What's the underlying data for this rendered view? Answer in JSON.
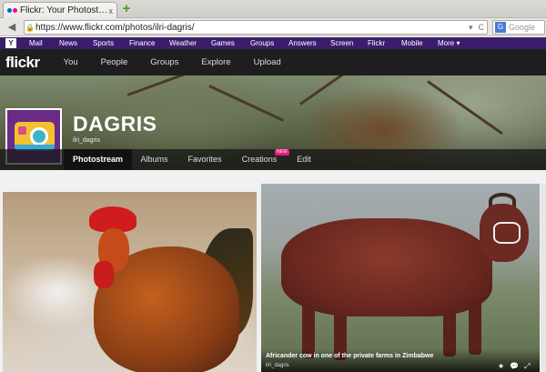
{
  "browser": {
    "tab_title": "Flickr: Your Photost…",
    "tab_close": "x",
    "new_tab": "+",
    "url": "https://www.flickr.com/photos/ilri-dagris/",
    "search_placeholder": "Google",
    "search_engine_icon": "G"
  },
  "yahoo_bar": {
    "logo": "Y",
    "items": [
      "Mail",
      "News",
      "Sports",
      "Finance",
      "Weather",
      "Games",
      "Groups",
      "Answers",
      "Screen",
      "Flickr",
      "Mobile",
      "More ▾"
    ]
  },
  "flickr": {
    "logo": "flickr",
    "nav": [
      "You",
      "People",
      "Groups",
      "Explore",
      "Upload"
    ]
  },
  "profile": {
    "name": "DAGRIS",
    "subtitle": "ilri_dagris",
    "tabs": [
      "Photostream",
      "Albums",
      "Favorites",
      "Creations",
      "Edit"
    ],
    "new_badge": "NEW"
  },
  "photos": [
    {
      "title": "",
      "user": ""
    },
    {
      "title": "Africander cow in one of the private farms in Zimbabwe",
      "user": "ilri_dagris",
      "icons": [
        "★",
        "💬",
        "⤢"
      ]
    }
  ],
  "colors": {
    "yahoo_purple": "#3c1d6b",
    "flickr_header": "#1e1e1e",
    "new_badge": "#e6197e"
  }
}
